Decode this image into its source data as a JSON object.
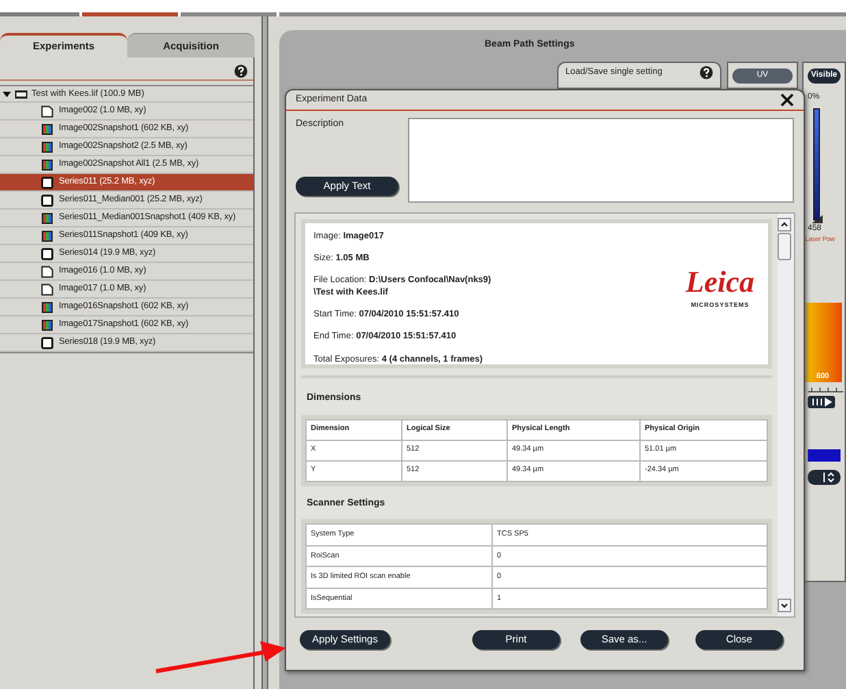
{
  "tabs": [
    {
      "label": "Experiments",
      "selected": true
    },
    {
      "label": "Acquisition",
      "selected": false
    }
  ],
  "tree": {
    "label": "Test with Kees.lif (100.9 MB)",
    "expanded": true,
    "children": [
      {
        "label": "Image002 (1.0 MB, xy)",
        "kind": "image",
        "selected": false
      },
      {
        "label": "Image002Snapshot1 (602 KB, xy)",
        "kind": "snapshot",
        "selected": false
      },
      {
        "label": "Image002Snapshot2 (2.5 MB, xy)",
        "kind": "snapshot",
        "selected": false
      },
      {
        "label": "Image002Snapshot All1 (2.5 MB, xy)",
        "kind": "snapshot",
        "selected": false
      },
      {
        "label": "Series011 (25.2 MB, xyz)",
        "kind": "series",
        "selected": true
      },
      {
        "label": "Series011_Median001 (25.2 MB, xyz)",
        "kind": "series",
        "selected": false
      },
      {
        "label": "Series011_Median001Snapshot1 (409 KB, xy)",
        "kind": "snapshot",
        "selected": false
      },
      {
        "label": "Series011Snapshot1 (409 KB, xy)",
        "kind": "snapshot",
        "selected": false
      },
      {
        "label": "Series014 (19.9 MB, xyz)",
        "kind": "series",
        "selected": false
      },
      {
        "label": "Image016 (1.0 MB, xy)",
        "kind": "image",
        "selected": false
      },
      {
        "label": "Image017 (1.0 MB, xy)",
        "kind": "image",
        "selected": false
      },
      {
        "label": "Image016Snapshot1 (602 KB, xy)",
        "kind": "snapshot",
        "selected": false
      },
      {
        "label": "Image017Snapshot1 (602 KB, xy)",
        "kind": "snapshot",
        "selected": false
      },
      {
        "label": "Series018 (19.9 MB, xyz)",
        "kind": "series",
        "selected": false
      }
    ]
  },
  "beam_path": {
    "title": "Beam Path Settings",
    "load_save": "Load/Save single setting",
    "modes": [
      {
        "label": "UV",
        "selected": false
      },
      {
        "label": "Visible",
        "selected": true
      }
    ],
    "laser": {
      "top_label": "0%",
      "level": 1,
      "value": "458",
      "caption": "Laser Pow"
    },
    "spectrum_label": "600"
  },
  "dialog": {
    "title": "Experiment Data",
    "description_label": "Description",
    "apply_text": "Apply Text",
    "info": [
      {
        "label": "Image:",
        "value": [
          "Image017"
        ]
      },
      {
        "label": "Size:",
        "value": [
          "1.05 MB"
        ]
      },
      {
        "label": "File Location:",
        "value": [
          "D:\\Users Confocal\\Nav(nks9)",
          "\\Test with Kees.lif"
        ]
      },
      {
        "label": "Start Time:",
        "value": [
          "07/04/2010 15:51:57.410"
        ]
      },
      {
        "label": "End Time:",
        "value": [
          "07/04/2010 15:51:57.410"
        ]
      },
      {
        "label": "Total Exposures:",
        "value": [
          "4 (4 channels, 1 frames)"
        ]
      }
    ],
    "logo": {
      "name": "Leica",
      "tagline": "MICROSYSTEMS"
    },
    "dimensions": {
      "title": "Dimensions",
      "columns": [
        "Dimension",
        "Logical Size",
        "Physical Length",
        "Physical Origin"
      ],
      "rows": [
        [
          "X",
          "512",
          "49.34 µm",
          "51.01 µm"
        ],
        [
          "Y",
          "512",
          "49.34 µm",
          "-24.34 µm"
        ]
      ]
    },
    "scanner": {
      "title": "Scanner Settings",
      "rows": [
        [
          "System Type",
          "TCS SP5"
        ],
        [
          "RoiScan",
          "0"
        ],
        [
          "Is 3D limited ROI scan enable",
          "0"
        ],
        [
          "IsSequential",
          "1"
        ]
      ]
    },
    "buttons": [
      "Apply Settings",
      "Print",
      "Save as...",
      "Close"
    ]
  }
}
